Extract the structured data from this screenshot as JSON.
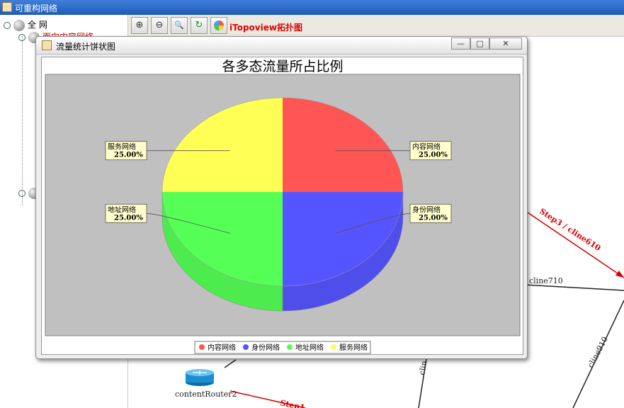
{
  "window": {
    "title": "可重构网络"
  },
  "tree": {
    "root_label": "全 网",
    "child_label": "面向内容网络"
  },
  "toolbar": {
    "zoom_in_glyph": "⊕",
    "zoom_out_glyph": "⊖",
    "zoom_fit_glyph": "🔍",
    "layout_glyph": "↻",
    "brand_label": "iTopoview拓扑图"
  },
  "topology": {
    "router_label": "contentRouter2",
    "link_labels": [
      "Step3 / cline610",
      "cline710",
      "cline910",
      "Step1",
      "clin"
    ]
  },
  "dialog": {
    "title": "流量统计饼状图",
    "minimize_glyph": "—",
    "maximize_glyph": "□",
    "close_glyph": "✕"
  },
  "chart_data": {
    "type": "pie",
    "title": "各多态流量所占比例",
    "categories": [
      "内容网络",
      "身份网络",
      "地址网络",
      "服务网络"
    ],
    "values": [
      25.0,
      25.0,
      25.0,
      25.0
    ],
    "value_labels": [
      "25.00%",
      "25.00%",
      "25.00%",
      "25.00%"
    ],
    "colors": [
      "#ff5555",
      "#5555ff",
      "#55ff55",
      "#ffff55"
    ],
    "plot_background": "#c0c0c0",
    "legend_position": "bottom",
    "style": "3d"
  }
}
